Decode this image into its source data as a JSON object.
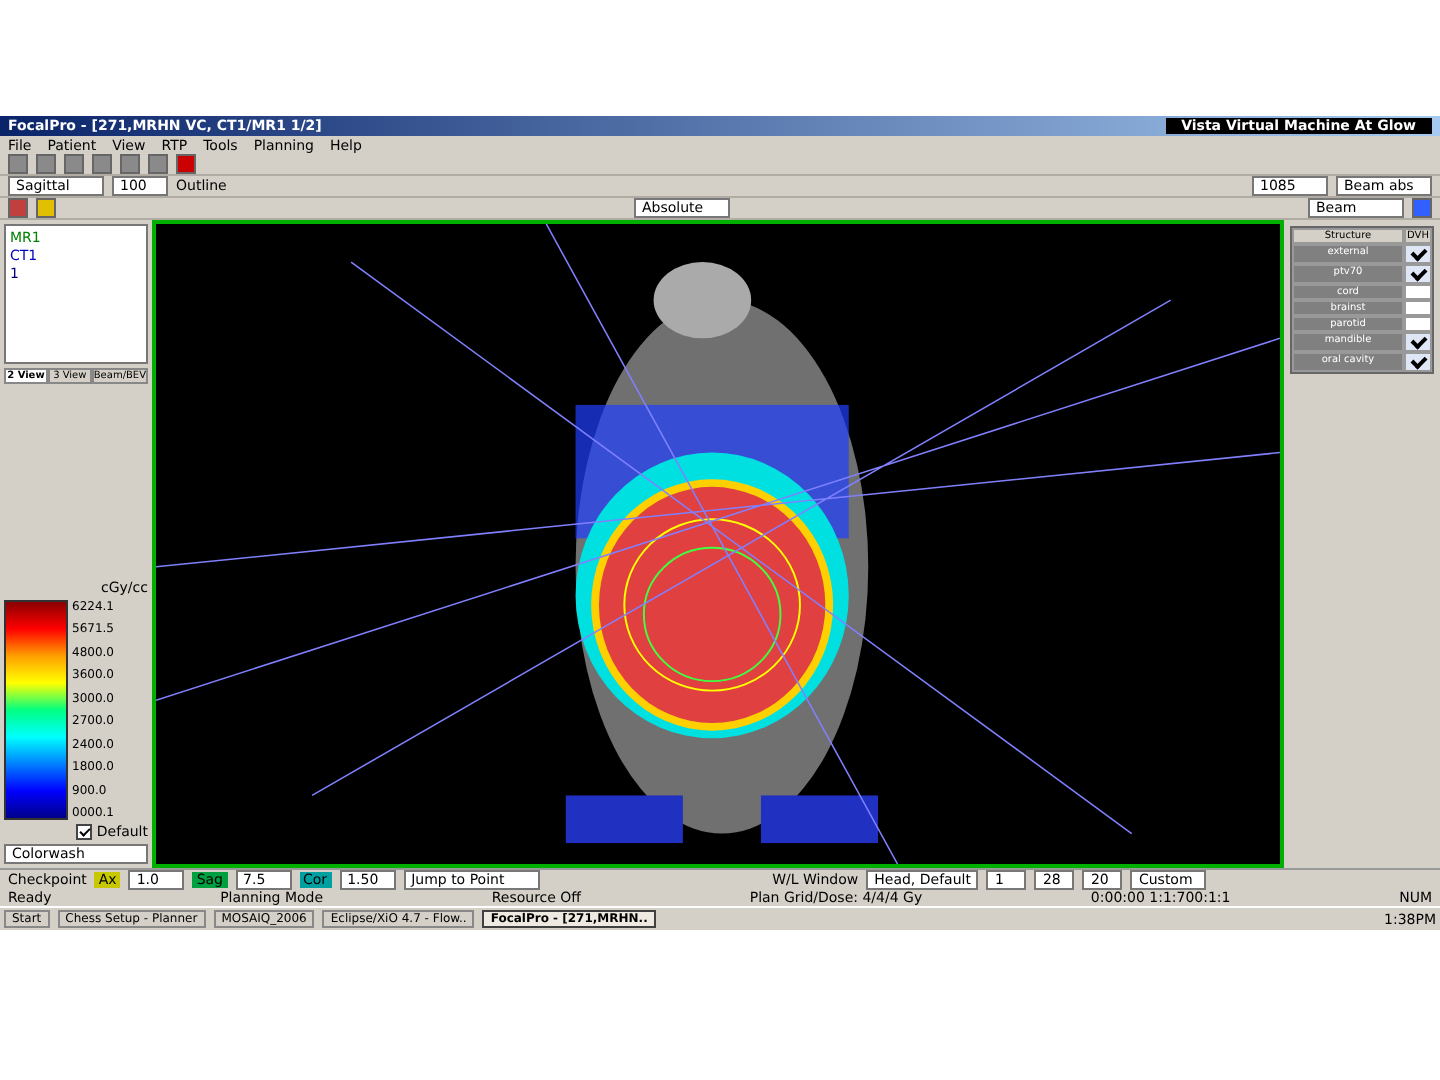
{
  "window": {
    "title": "FocalPro - [271,MRHN VC, CT1/MR1 1/2]",
    "side_title": "Vista  Virtual Machine  At Glow"
  },
  "menu": [
    "File",
    "Patient",
    "View",
    "RTP",
    "Tools",
    "Planning",
    "Help"
  ],
  "toolbar": {
    "dropdown": "Sagittal",
    "zoom": "100",
    "option": "Outline",
    "field_1": "1085",
    "field_2": "Beam abs",
    "view_select": "Absolute",
    "right_select": "Beam"
  },
  "left_panel": {
    "tree": [
      {
        "label": "MR1",
        "color": "#008000"
      },
      {
        "label": "CT1",
        "color": "#0000c0"
      },
      {
        "label": "1",
        "color": "#000080"
      }
    ],
    "tabs": [
      {
        "label": "2 View",
        "selected": true
      },
      {
        "label": "3 View",
        "selected": false
      },
      {
        "label": "Beam/BEV",
        "selected": false
      }
    ],
    "colorbar_title": "cGy/cc",
    "colorbar_values": [
      "6224.1",
      "5671.5",
      "4800.0",
      "3600.0",
      "3000.0",
      "2700.0",
      "2400.0",
      "1800.0",
      "900.0",
      "0000.1"
    ],
    "defaults": {
      "label": "Default",
      "checked": true
    },
    "select": "Colorwash"
  },
  "structures": {
    "header": "Structure",
    "header_2": "DVH",
    "rows": [
      {
        "name": "external",
        "checked": true
      },
      {
        "name": "ptv70",
        "checked": true
      },
      {
        "name": "cord",
        "checked": false
      },
      {
        "name": "brainst",
        "checked": false
      },
      {
        "name": "parotid",
        "checked": false
      },
      {
        "name": "mandible",
        "checked": true
      },
      {
        "name": "oral cavity",
        "checked": true
      }
    ]
  },
  "bottom_bar": {
    "checkbox": "Checkpoint",
    "fields": [
      {
        "tag": "Ax",
        "value": "1.0",
        "color": "#c8c800"
      },
      {
        "tag": "Sag",
        "value": "7.5",
        "color": "#00a040"
      },
      {
        "tag": "Cor",
        "value": "1.50",
        "color": "#00a0a0"
      }
    ],
    "jump": "Jump to Point",
    "wl": "W/L Window",
    "wl_select": "Head, Default",
    "n1": "1",
    "n2": "28",
    "n3": "20",
    "preset": "Custom"
  },
  "status_bar": [
    "Ready",
    "Planning Mode",
    "Resource Off",
    "Plan Grid/Dose: 4/4/4 Gy",
    "0:00:00 1:1:700:1:1",
    "NUM"
  ],
  "taskbar": {
    "start": "Start",
    "items": [
      {
        "label": "Chess Setup - Planner",
        "selected": false
      },
      {
        "label": "MOSAIQ_2006",
        "selected": false
      },
      {
        "label": "Eclipse/XiO 4.7 - Flow..",
        "selected": false
      },
      {
        "label": "FocalPro - [271,MRHN..",
        "selected": true
      }
    ],
    "time": "1:38PM"
  }
}
